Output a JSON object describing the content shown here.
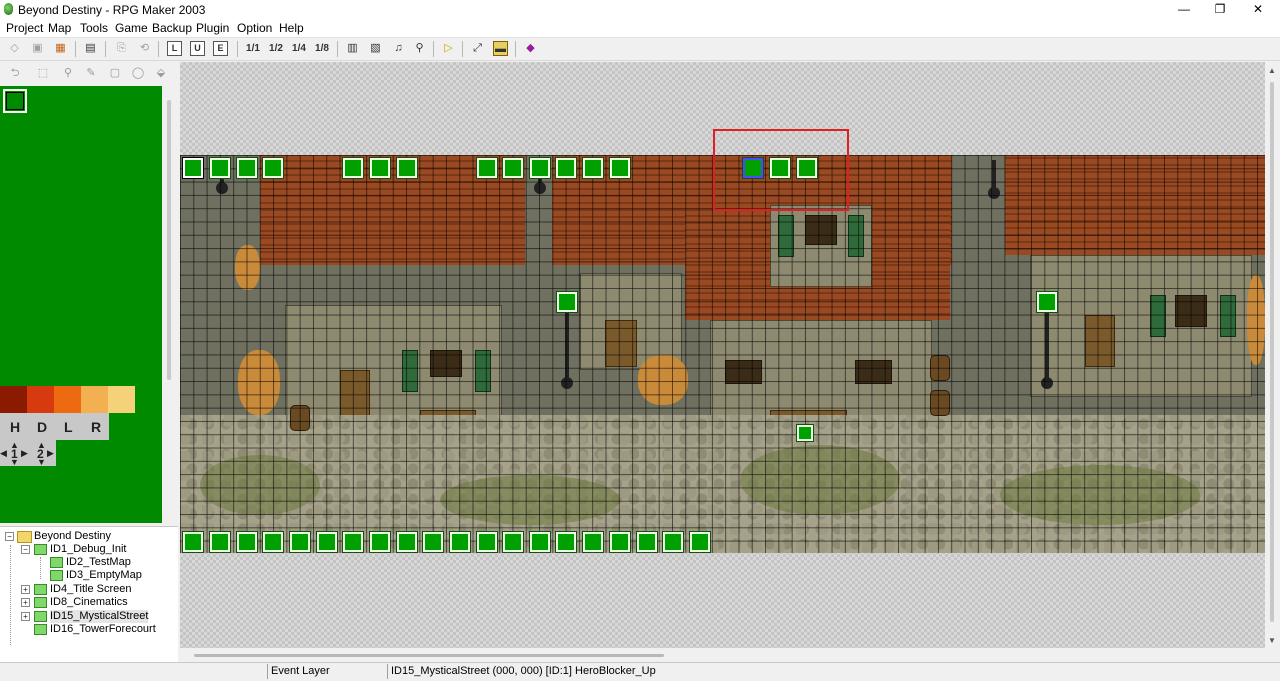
{
  "window": {
    "title": "Beyond Destiny - RPG Maker 2003",
    "minimize": "—",
    "maximize": "❐",
    "close": "✕"
  },
  "menu": [
    "Project",
    "Map",
    "Tools",
    "Game",
    "Backup",
    "Plugin",
    "Option",
    "Help"
  ],
  "toolbar": {
    "zoom_1_1": "1/1",
    "zoom_1_2": "1/2",
    "zoom_1_4": "1/4",
    "zoom_1_8": "1/8"
  },
  "palette": {
    "layer_keys": [
      "H",
      "D",
      "L",
      "R"
    ],
    "layer_numbers": [
      "1",
      "2"
    ],
    "colors": {
      "palette_bg": "#008a00",
      "swatch_1": "#8a1a00",
      "swatch_2": "#d83a10",
      "swatch_3": "#ee6a10",
      "swatch_4": "#f2b050",
      "swatch_5": "#f5d27a"
    }
  },
  "tree": {
    "root": "Beyond Destiny",
    "items": [
      {
        "label": "ID1_Debug_Init",
        "expander": "−"
      },
      {
        "label": "ID2_TestMap",
        "expander": ""
      },
      {
        "label": "ID3_EmptyMap",
        "expander": ""
      },
      {
        "label": "ID4_Title Screen",
        "expander": "+"
      },
      {
        "label": "ID8_Cinematics",
        "expander": "+"
      },
      {
        "label": "ID15_MysticalStreet",
        "expander": "+"
      },
      {
        "label": "ID16_TowerForecourt",
        "expander": ""
      }
    ]
  },
  "status": {
    "layer": "Event Layer",
    "info": "ID15_MysticalStreet (000, 000) [ID:1] HeroBlocker_Up"
  },
  "colors": {
    "event_fill": "#00a000",
    "selection_red": "#e02020",
    "selection_blue": "#4a4aff"
  }
}
